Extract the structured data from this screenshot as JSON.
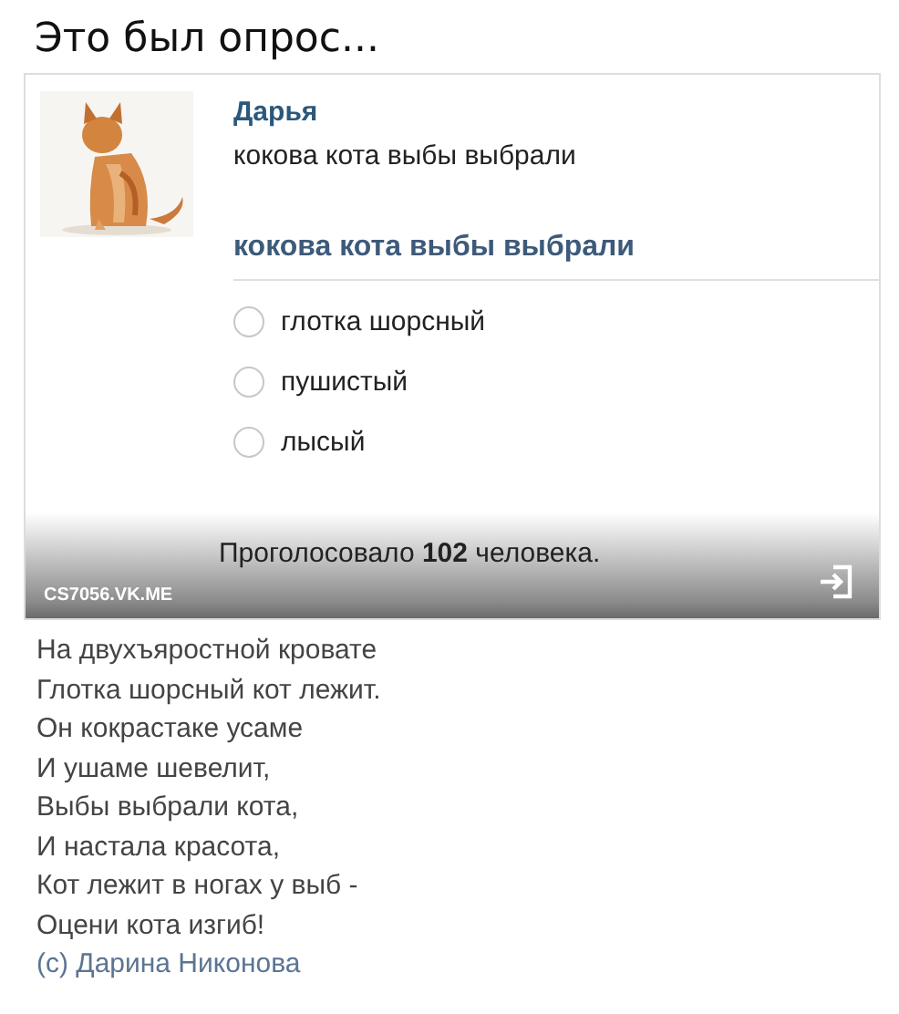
{
  "heading": "Это был опрос...",
  "post": {
    "author": "Дарья",
    "text": "кокова кота выбы выбрали",
    "poll": {
      "title": "кокова кота выбы выбрали",
      "options": [
        {
          "label": "глотка шорсный",
          "selected": false
        },
        {
          "label": "пушистый",
          "selected": false
        },
        {
          "label": "лысый",
          "selected": false
        }
      ],
      "votes": "Проголосовало **102** человека."
    }
  },
  "image_overlay": {
    "source": "CS7056.VK.ME"
  },
  "poem": {
    "lines": [
      "На двухъяростной кровате",
      "Глотка шорсный кот лежит.",
      "Он кокрастаке усаме",
      "И ушаме шевелит,",
      "Выбы выбрали кота,",
      "И настала красота,",
      "Кот лежит в ногах у выб -",
      "Оцени кота изгиб!"
    ],
    "credit": "(c) Дарина Никонова"
  }
}
